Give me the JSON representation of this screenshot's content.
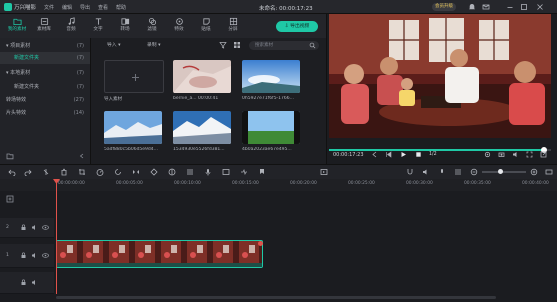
{
  "app": {
    "name": "万兴喵影",
    "project_title": "未命名: 00:00:17:23",
    "member_label": "会员升级"
  },
  "menu": [
    "文件",
    "编辑",
    "导出",
    "查看",
    "帮助"
  ],
  "tools": [
    {
      "label": "我的素材",
      "icon": "folder-icon",
      "active": true
    },
    {
      "label": "素材库",
      "icon": "library-icon"
    },
    {
      "label": "音频",
      "icon": "music-icon"
    },
    {
      "label": "文字",
      "icon": "text-icon"
    },
    {
      "label": "转场",
      "icon": "transition-icon"
    },
    {
      "label": "滤镜",
      "icon": "filter-icon"
    },
    {
      "label": "特效",
      "icon": "effects-icon"
    },
    {
      "label": "贴纸",
      "icon": "sticker-icon"
    },
    {
      "label": "分屏",
      "icon": "split-screen-icon"
    }
  ],
  "export_label": "⇩ 导出视频",
  "sidebar": {
    "items": [
      {
        "label": "▾ 项目素材",
        "count": "(7)"
      },
      {
        "label": "新建文件夹",
        "count": "(7)",
        "selected": true
      },
      {
        "label": "▾ 本地素材",
        "count": "(7)"
      },
      {
        "label": "新建文件夹",
        "count": "(7)"
      },
      {
        "label": "转场特效",
        "count": "(27)"
      },
      {
        "label": "片头特效",
        "count": "(14)"
      }
    ]
  },
  "media": {
    "import_dropdown": "导入 ▾",
    "record_dropdown": "录制 ▾",
    "search_placeholder": "搜索素材",
    "import_label": "导入素材",
    "clips": [
      {
        "name": "bernie_a...",
        "duration": "00:00:41"
      },
      {
        "name": "0h5927e71f6f5-1766...",
        "duration": ""
      },
      {
        "name": "5adf880c5b06d5e9d4...",
        "duration": ""
      },
      {
        "name": "1534930e5526fd381...",
        "duration": ""
      },
      {
        "name": "4b0a2023ae67e495...",
        "duration": ""
      }
    ]
  },
  "preview": {
    "timecode": "00:00:17:23",
    "page": "1/2",
    "progress": 0.97
  },
  "ruler": [
    "00:00:00:00",
    "00:00:05:00",
    "00:00:10:00",
    "00:00:15:00",
    "00:00:20:00",
    "00:00:25:00",
    "00:00:30:00",
    "00:00:35:00",
    "00:00:40:00"
  ],
  "tracks": [
    {
      "name": "2"
    },
    {
      "name": "1"
    }
  ],
  "colors": {
    "accent": "#1fc8a6",
    "playhead": "#e0524b",
    "bg": "#1b1c20"
  }
}
